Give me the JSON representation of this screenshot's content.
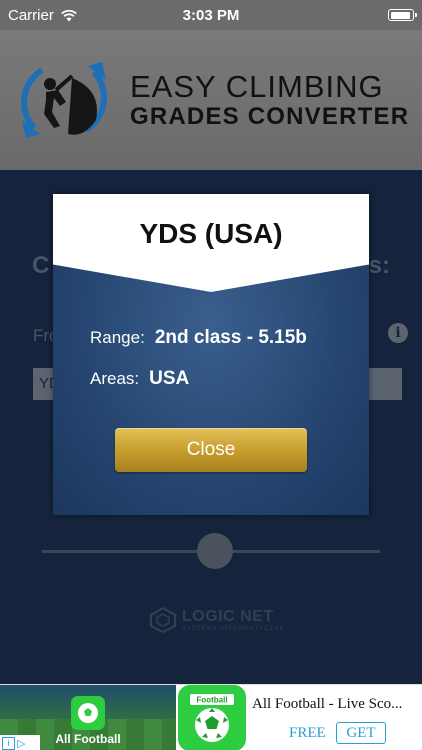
{
  "status_bar": {
    "carrier": "Carrier",
    "time": "3:03 PM",
    "wifi_icon": "wifi-icon",
    "battery_icon": "battery-icon"
  },
  "header": {
    "logo_line1": "EASY CLIMBING",
    "logo_line2": "GRADES CONVERTER",
    "logo_icon": "climber-logo-icon"
  },
  "underlying": {
    "heading_left": "C",
    "heading_right": "s:",
    "from_label": "Fro",
    "select_value": "YD",
    "info_icon": "info-icon"
  },
  "brand": {
    "name": "LOGIC NET",
    "subtitle": "SYSTEMY INFORMATYCZNE"
  },
  "modal": {
    "title": "YDS (USA)",
    "range_label": "Range:",
    "range_value": "2nd class - 5.15b",
    "areas_label": "Areas:",
    "areas_value": "USA",
    "close_label": "Close"
  },
  "ad": {
    "image_app_label": "All Football",
    "icon_label": "Football",
    "title": "All Football - Live Sco...",
    "price": "FREE",
    "get_label": "GET"
  },
  "colors": {
    "accent_gold": "#c59b2b",
    "modal_blue": "#22416b",
    "ad_blue": "#2a9fd6",
    "ad_green": "#2ecc40"
  }
}
